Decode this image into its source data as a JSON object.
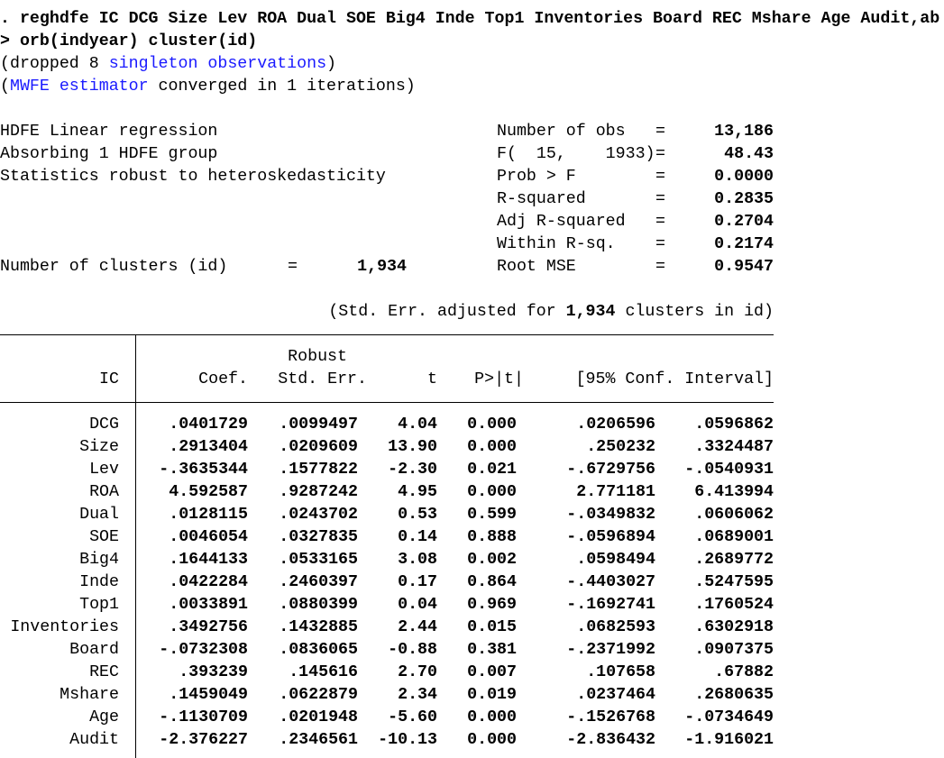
{
  "command": {
    "line1": ". reghdfe IC DCG Size Lev ROA Dual SOE Big4 Inde Top1 Inventories Board REC Mshare Age Audit,ab",
    "line2": "> orb(indyear) cluster(id)"
  },
  "notes": {
    "dropped_prefix": "(dropped 8 ",
    "dropped_link": "singleton observations",
    "dropped_suffix": ")",
    "mwfe_prefix": "(",
    "mwfe_link": "MWFE estimator",
    "mwfe_suffix": " converged in 1 iterations)",
    "link_color": "#1a1aff"
  },
  "header": {
    "left": [
      "HDFE Linear regression",
      "Absorbing 1 HDFE group",
      "Statistics robust to heteroskedasticity"
    ],
    "clusters_label": "Number of clusters (id)",
    "clusters_eq": "=",
    "clusters_value": "1,934",
    "stats": [
      {
        "label": "Number of obs",
        "eq": "=",
        "value": "13,186"
      },
      {
        "label": "F(  15,    1933)",
        "eq": "=",
        "value": "48.43"
      },
      {
        "label": "Prob > F",
        "eq": "=",
        "value": "0.0000"
      },
      {
        "label": "R-squared",
        "eq": "=",
        "value": "0.2835"
      },
      {
        "label": "Adj R-squared",
        "eq": "=",
        "value": "0.2704"
      },
      {
        "label": "Within R-sq.",
        "eq": "=",
        "value": "0.2174"
      },
      {
        "label": "Root MSE",
        "eq": "=",
        "value": "0.9547"
      }
    ],
    "se_note_prefix": "(Std. Err. adjusted for ",
    "se_note_value": "1,934",
    "se_note_suffix": " clusters in id)"
  },
  "table": {
    "robust_label": "Robust",
    "columns": [
      "IC",
      "Coef.",
      "Std. Err.",
      "t",
      "P>|t|",
      "[95% Conf. Interval]"
    ],
    "rows": [
      [
        "DCG",
        ".0401729",
        ".0099497",
        "4.04",
        "0.000",
        ".0206596",
        ".0596862"
      ],
      [
        "Size",
        ".2913404",
        ".0209609",
        "13.90",
        "0.000",
        ".250232",
        ".3324487"
      ],
      [
        "Lev",
        "-.3635344",
        ".1577822",
        "-2.30",
        "0.021",
        "-.6729756",
        "-.0540931"
      ],
      [
        "ROA",
        "4.592587",
        ".9287242",
        "4.95",
        "0.000",
        "2.771181",
        "6.413994"
      ],
      [
        "Dual",
        ".0128115",
        ".0243702",
        "0.53",
        "0.599",
        "-.0349832",
        ".0606062"
      ],
      [
        "SOE",
        ".0046054",
        ".0327835",
        "0.14",
        "0.888",
        "-.0596894",
        ".0689001"
      ],
      [
        "Big4",
        ".1644133",
        ".0533165",
        "3.08",
        "0.002",
        ".0598494",
        ".2689772"
      ],
      [
        "Inde",
        ".0422284",
        ".2460397",
        "0.17",
        "0.864",
        "-.4403027",
        ".5247595"
      ],
      [
        "Top1",
        ".0033891",
        ".0880399",
        "0.04",
        "0.969",
        "-.1692741",
        ".1760524"
      ],
      [
        "Inventories",
        ".3492756",
        ".1432885",
        "2.44",
        "0.015",
        ".0682593",
        ".6302918"
      ],
      [
        "Board",
        "-.0732308",
        ".0836065",
        "-0.88",
        "0.381",
        "-.2371992",
        ".0907375"
      ],
      [
        "REC",
        ".393239",
        ".145616",
        "2.70",
        "0.007",
        ".107658",
        ".67882"
      ],
      [
        "Mshare",
        ".1459049",
        ".0622879",
        "2.34",
        "0.019",
        ".0237464",
        ".2680635"
      ],
      [
        "Age",
        "-.1130709",
        ".0201948",
        "-5.60",
        "0.000",
        "-.1526768",
        "-.0734649"
      ],
      [
        "Audit",
        "-2.376227",
        ".2346561",
        "-10.13",
        "0.000",
        "-2.836432",
        "-1.916021"
      ]
    ]
  }
}
